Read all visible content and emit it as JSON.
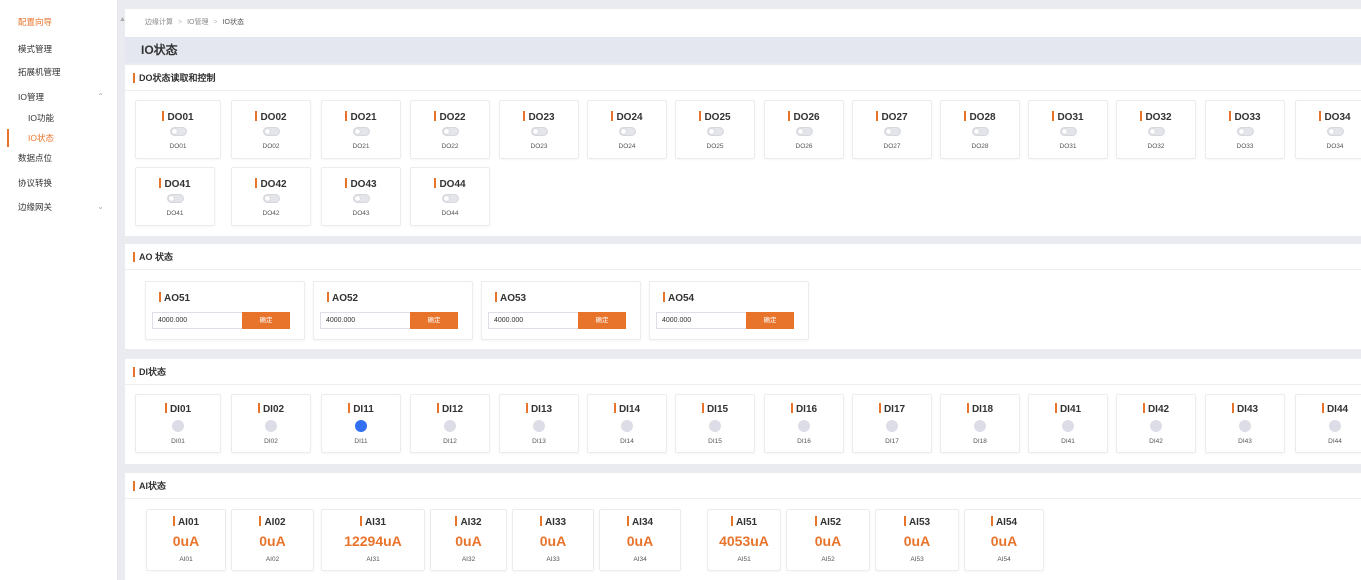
{
  "sidebar": {
    "items": [
      {
        "label": "配置向导",
        "state": "active-top"
      },
      {
        "label": "模式管理"
      },
      {
        "label": "拓展机管理"
      },
      {
        "label": "IO管理",
        "expanded": true
      },
      {
        "label": "IO功能",
        "sub": true
      },
      {
        "label": "IO状态",
        "sub": true,
        "state": "active"
      },
      {
        "label": "数据点位"
      },
      {
        "label": "协议转换"
      },
      {
        "label": "边缘网关",
        "expandable": true
      }
    ]
  },
  "breadcrumb": [
    "边缘计算",
    "IO管理",
    "IO状态"
  ],
  "page_title": "IO状态",
  "do_section": {
    "title": "DO状态读取和控制",
    "items": [
      {
        "name": "DO01",
        "on": false
      },
      {
        "name": "DO02",
        "on": false
      },
      {
        "name": "DO21",
        "on": false
      },
      {
        "name": "DO22",
        "on": false
      },
      {
        "name": "DO23",
        "on": false
      },
      {
        "name": "DO24",
        "on": false
      },
      {
        "name": "DO25",
        "on": false
      },
      {
        "name": "DO26",
        "on": false
      },
      {
        "name": "DO27",
        "on": false
      },
      {
        "name": "DO28",
        "on": false
      },
      {
        "name": "DO31",
        "on": false
      },
      {
        "name": "DO32",
        "on": false
      },
      {
        "name": "DO33",
        "on": false
      },
      {
        "name": "DO34",
        "on": false
      },
      {
        "name": "DO41",
        "on": false
      },
      {
        "name": "DO42",
        "on": false
      },
      {
        "name": "DO43",
        "on": false
      },
      {
        "name": "DO44",
        "on": false
      }
    ]
  },
  "ao_section": {
    "title": "AO 状态",
    "items": [
      {
        "name": "AO51",
        "value": "4000.000",
        "button": "确定"
      },
      {
        "name": "AO52",
        "value": "4000.000",
        "button": "确定"
      },
      {
        "name": "AO53",
        "value": "4000.000",
        "button": "确定"
      },
      {
        "name": "AO54",
        "value": "4000.000",
        "button": "确定"
      }
    ]
  },
  "di_section": {
    "title": "DI状态",
    "items": [
      {
        "name": "DI01",
        "on": false
      },
      {
        "name": "DI02",
        "on": false
      },
      {
        "name": "DI11",
        "on": true
      },
      {
        "name": "DI12",
        "on": false
      },
      {
        "name": "DI13",
        "on": false
      },
      {
        "name": "DI14",
        "on": false
      },
      {
        "name": "DI15",
        "on": false
      },
      {
        "name": "DI16",
        "on": false
      },
      {
        "name": "DI17",
        "on": false
      },
      {
        "name": "DI18",
        "on": false
      },
      {
        "name": "DI41",
        "on": false
      },
      {
        "name": "DI42",
        "on": false
      },
      {
        "name": "DI43",
        "on": false
      },
      {
        "name": "DI44",
        "on": false
      }
    ]
  },
  "ai_section": {
    "title": "AI状态",
    "items": [
      {
        "name": "AI01",
        "value": "0uA"
      },
      {
        "name": "AI02",
        "value": "0uA"
      },
      {
        "name": "AI31",
        "value": "12294uA"
      },
      {
        "name": "AI32",
        "value": "0uA"
      },
      {
        "name": "AI33",
        "value": "0uA"
      },
      {
        "name": "AI34",
        "value": "0uA"
      },
      {
        "name": "AI51",
        "value": "4053uA"
      },
      {
        "name": "AI52",
        "value": "0uA"
      },
      {
        "name": "AI53",
        "value": "0uA"
      },
      {
        "name": "AI54",
        "value": "0uA"
      }
    ]
  },
  "colors": {
    "accent": "#e8742b",
    "led_on": "#3170f0",
    "led_off": "#dcdde6"
  },
  "icons": {
    "collapse": "chevron-up-icon",
    "expand": "chevron-down-icon",
    "scroll": "caret-up-icon"
  }
}
